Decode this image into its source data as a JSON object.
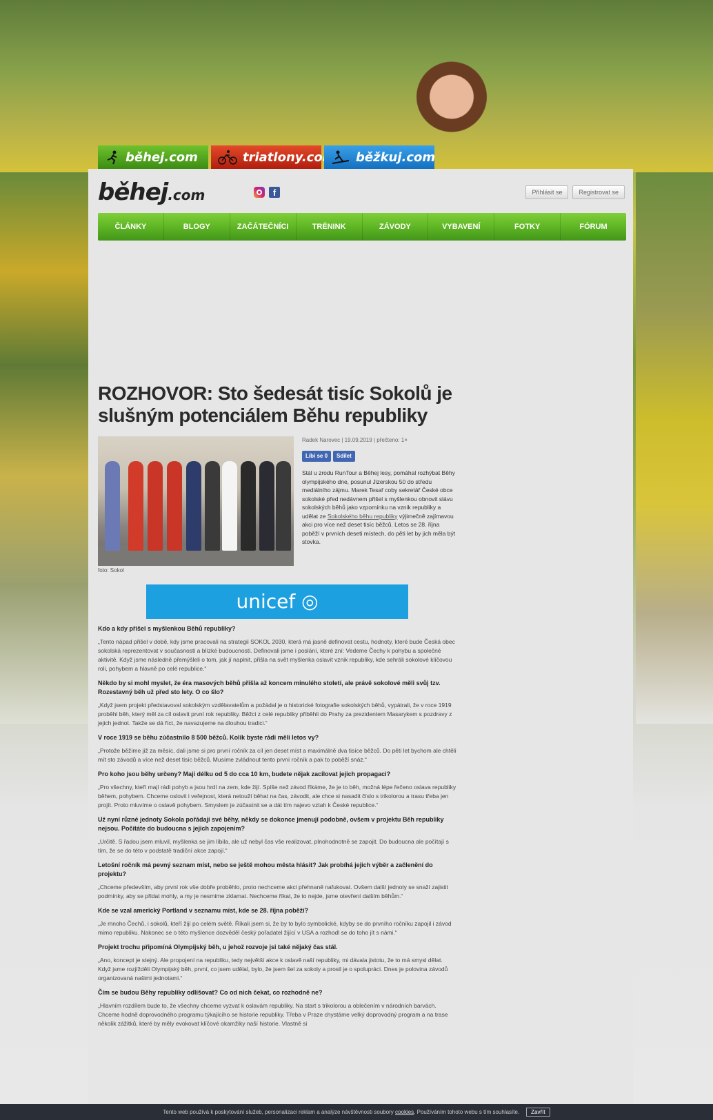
{
  "sites": [
    {
      "label": "běhej.com",
      "icon": "runner-icon"
    },
    {
      "label": "triatlony.com",
      "icon": "cyclist-icon"
    },
    {
      "label": "běžkuj.com",
      "icon": "skier-icon"
    }
  ],
  "header": {
    "logo": "běhej",
    "logo_suffix": ".com",
    "login": "Přihlásit se",
    "register": "Registrovat se"
  },
  "nav": [
    "ČLÁNKY",
    "BLOGY",
    "ZAČÁTEČNÍCI",
    "TRÉNINK",
    "ZÁVODY",
    "VYBAVENÍ",
    "FOTKY",
    "FÓRUM"
  ],
  "article": {
    "title": "ROZHOVOR: Sto šedesát tisíc Sokolů je slušným potenciálem Běhu republiky",
    "meta": "Radek Narovec | 19.09.2019 | přečteno: 1×",
    "like": "Líbí se 0",
    "share": "Sdílet",
    "photo_caption": "foto: Sokol",
    "lead_1": "Stál u zrodu RunTour a Běhej lesy, pomáhal rozhýbat Běhy olympijského dne, posunul Jizerskou 50 do středu mediálního zájmu. Marek Tesař coby sekretář České obce sokolské před nedávnem přišel s myšlenkou obnovit slávu sokolských běhů jako vzpomínku na vznik republiky a udělat ze ",
    "lead_link": "Sokolského běhu republiky",
    "lead_2": " výjimečně zajímavou akci pro více než deset tisíc běžců. Letos se 28. října poběží v prvních deseti místech, do pěti let by jich měla být stovka.",
    "banner": "unicef",
    "qa": [
      {
        "q": "Kdo a kdy přišel s myšlenkou Běhů republiky?",
        "a": "„Tento nápad přišel v době, kdy jsme pracovali na strategii SOKOL 2030, která má jasně definovat cestu, hodnoty, které bude Česká obec sokolská reprezentovat v současnosti a blízké budoucnosti. Definovali jsme i poslání, které zní: Vedeme Čechy k pohybu a společné aktivitě. Když jsme následně přemýšleli o tom, jak jí naplnit, přišla na svět myšlenka oslavit vznik republiky, kde sehráli sokolové klíčovou roli, pohybem a hlavně po celé republice.“"
      },
      {
        "q": "Někdo by si mohl myslet, že éra masových běhů přišla až koncem minulého století, ale právě sokolové měli svůj tzv. Rozestavný běh už před sto lety. O co šlo?",
        "a": "„Když jsem projekt představoval sokolským vzdělavatelům a požádal je o historické fotografie sokolských běhů, vypátrali, že v roce 1919 proběhl běh, který měl za cíl oslavit první rok republiky. Běžci z celé republiky přiběhli do Prahy za prezidentem Masarykem s pozdravy z jejich jednot. Takže se dá říct, že navazujeme na dlouhou tradici.“"
      },
      {
        "q": "V roce 1919 se běhu zúčastnilo 8 500 běžců. Kolik byste rádi měli letos vy?",
        "a": "„Protože běžíme již za měsíc, dali jsme si pro první ročník za cíl jen deset míst a maximálně dva tisíce běžců. Do pěti let bychom ale chtěli mít sto závodů a více než deset tisíc běžců. Musíme zvládnout tento první ročník a pak to poběží snáz.“"
      },
      {
        "q": "Pro koho jsou běhy určeny? Mají délku od 5 do cca 10 km, budete nějak zacilovat jejich propagaci?",
        "a": "„Pro všechny, kteří mají rádi pohyb a jsou hrdí na zem, kde žijí. Spíše než závod říkáme, že je to běh, možná lépe řečeno oslava republiky během, pohybem. Chceme oslovit i veřejnost, která netouží běhat na čas, závodit, ale chce si nasadit číslo s trikolorou a trasu třeba jen projít. Proto mluvíme o oslavě pohybem. Smyslem je zúčastnit se a dát tím najevo vztah k České republice.“"
      },
      {
        "q": "Už nyní různé jednoty Sokola pořádají své běhy, někdy se dokonce jmenují podobně, ovšem v projektu Běh republiky nejsou. Počítáte do budoucna s jejich zapojením?",
        "a": "„Určitě. S řadou jsem mluvil, myšlenka se jim líbila, ale už nebyl čas vše realizovat, plnohodnotně se zapojit. Do budoucna ale počítají s tím, že se do této v podstatě tradiční akce zapojí.“"
      },
      {
        "q": "Letošní ročník má pevný seznam míst, nebo se ještě mohou města hlásit? Jak probíhá jejich výběr a začlenění do projektu?",
        "a": "„Chceme především, aby první rok vše dobře proběhlo, proto nechceme akci přehnaně nafukovat. Ovšem další jednoty se snaží zajistit podmínky, aby se přidat mohly, a my je nesmíme zklamat. Nechceme říkat, že to nejde, jsme otevření dalším běhům.“"
      },
      {
        "q": "Kde se vzal americký Portland v seznamu míst, kde se 28. října poběží?",
        "a": "„Je mnoho Čechů, i sokolů, kteří žijí po celém světě. Říkali jsem si, že by to bylo symbolické, kdyby se do prvního ročníku zapojil i závod mimo republiku. Nakonec se o této myšlence dozvěděl český pořadatel žijící v USA a rozhodl se do toho jít s námi.“"
      },
      {
        "q": "Projekt trochu připomíná Olympijský běh, u jehož rozvoje jsi také nějaký čas stál.",
        "a": "„Ano, koncept je stejný. Ale propojení na republiku, tedy největší akce k oslavě naší republiky, mi dávala jistotu, že to má smysl dělat. Když jsme rozjížděli Olympijský běh, první, co jsem udělal, bylo, že jsem šel za sokoly a prosil je o spolupráci. Dnes je polovina závodů organizovaná našimi jednotami.“"
      },
      {
        "q": "Čím se budou Běhy republiky odlišovat? Co od nich čekat, co rozhodně ne?",
        "a": "„Hlavním rozdílem bude to, že všechny chceme vyzvat k oslavám republiky. Na start s trikolorou a oblečením v národních barvách. Chceme hodně doprovodného programu týkajícího se historie republiky. Třeba v Praze chystáme velký doprovodný program a na trase několik zážitků, které by měly evokovat klíčové okamžiky naší historie. Vlastně si"
      }
    ]
  },
  "cookie": {
    "text": "Tento web používá k poskytování služeb, personalizaci reklam a analýze návštěvnosti soubory",
    "link": "cookies",
    "text2": ". Používáním tohoto webu s tím souhlasíte.",
    "close": "Zavřít"
  }
}
